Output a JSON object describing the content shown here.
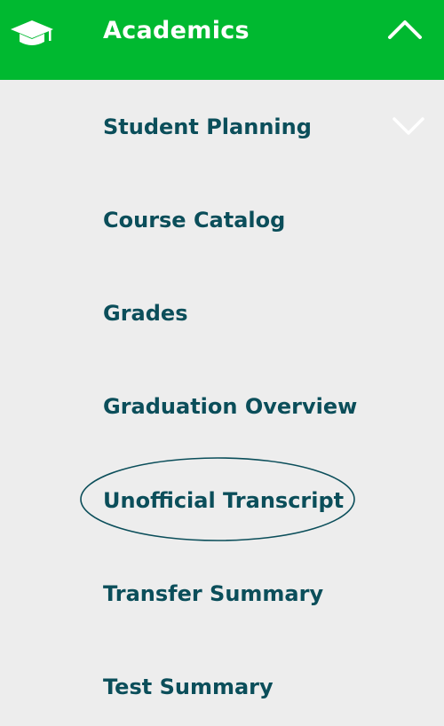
{
  "header": {
    "title": "Academics",
    "icon": "graduation-cap-icon",
    "toggle_icon": "chevron-up-icon",
    "background_color": "#00b930"
  },
  "menu_items": [
    {
      "label": "Student Planning",
      "has_submenu": true,
      "toggle_icon": "chevron-down-icon"
    },
    {
      "label": "Course Catalog"
    },
    {
      "label": "Grades"
    },
    {
      "label": "Graduation Overview"
    },
    {
      "label": "Unofficial Transcript",
      "highlighted": true
    },
    {
      "label": "Transfer Summary"
    },
    {
      "label": "Test Summary"
    }
  ],
  "colors": {
    "menu_background": "#ededed",
    "item_text": "#0b4e5a",
    "highlight_ellipse": "#0b4e5a"
  }
}
